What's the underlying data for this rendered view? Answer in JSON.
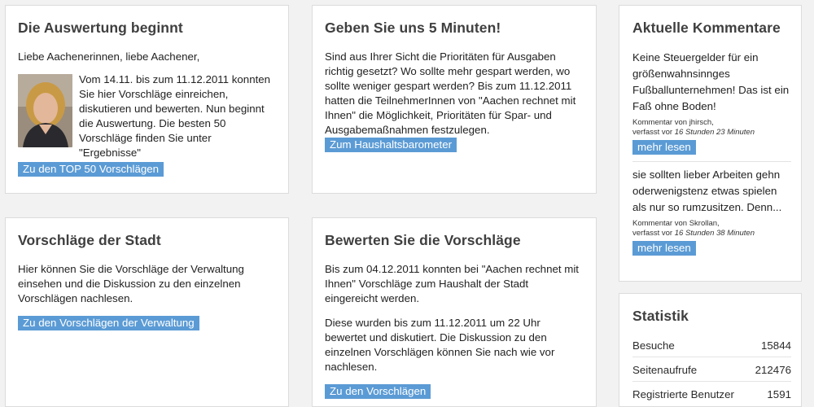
{
  "auswertung": {
    "title": "Die Auswertung beginnt",
    "greeting": "Liebe Aachenerinnen, liebe Aachener,",
    "text": "Vom 14.11. bis zum 11.12.2011 konnten Sie hier Vorschläge einreichen, diskutieren und bewerten. Nun beginnt die Auswertung. Die besten 50 Vorschläge finden Sie unter \"Ergebnisse\"",
    "button": "Zu den TOP 50 Vorschlägen"
  },
  "minuten": {
    "title": "Geben Sie uns 5 Minuten!",
    "text": "Sind aus Ihrer Sicht die Prioritäten für Ausgaben richtig gesetzt? Wo sollte mehr gespart werden, wo sollte weniger gespart werden? Bis zum 11.12.2011 hatten die TeilnehmerInnen von \"Aachen rechnet mit Ihnen\" die Möglichkeit, Prioritäten für Spar- und Ausgabemaßnahmen festzulegen.",
    "button": "Zum Haushaltsbarometer"
  },
  "kommentare": {
    "title": "Aktuelle Kommentare",
    "items": [
      {
        "text": "Keine Steuergelder für ein größenwahnsinnges Fußballunternehmen! Das ist ein Faß ohne Boden!",
        "author_line": "Kommentar von jhirsch,",
        "time_prefix": "verfasst vor",
        "time": "16 Stunden 23 Minuten",
        "button": "mehr lesen"
      },
      {
        "text": "sie sollten lieber Arbeiten gehn oderwenigstenz etwas spielen als nur so rumzusitzen. Denn...",
        "author_line": "Kommentar von Skrollan,",
        "time_prefix": "verfasst vor",
        "time": "16 Stunden 38 Minuten",
        "button": "mehr lesen"
      }
    ]
  },
  "stadt": {
    "title": "Vorschläge der Stadt",
    "text": "Hier können Sie die Vorschläge der Verwaltung einsehen und die Diskussion zu den einzelnen Vorschlägen nachlesen.",
    "button": "Zu den Vorschlägen der Verwaltung"
  },
  "bewerten": {
    "title": "Bewerten Sie die Vorschläge",
    "text1": "Bis zum 04.12.2011 konnten bei \"Aachen rechnet mit Ihnen\" Vorschläge zum Haushalt der Stadt eingereicht werden.",
    "text2": "Diese wurden bis zum 11.12.2011 um 22 Uhr bewertet und diskutiert. Die Diskussion zu den einzelnen Vorschlägen können Sie nach wie vor nachlesen.",
    "button": "Zu den Vorschlägen"
  },
  "statistik": {
    "title": "Statistik",
    "rows": [
      {
        "label": "Besuche",
        "value": "15844"
      },
      {
        "label": "Seitenaufrufe",
        "value": "212476"
      },
      {
        "label": "Registrierte Benutzer",
        "value": "1591"
      }
    ]
  },
  "colors": {
    "button_bg": "#5b9bd5",
    "card_bg": "#ffffff",
    "page_bg": "#f2f2f2",
    "heading": "#3f3f3f"
  },
  "icons": {
    "portrait": "portrait-photo"
  }
}
